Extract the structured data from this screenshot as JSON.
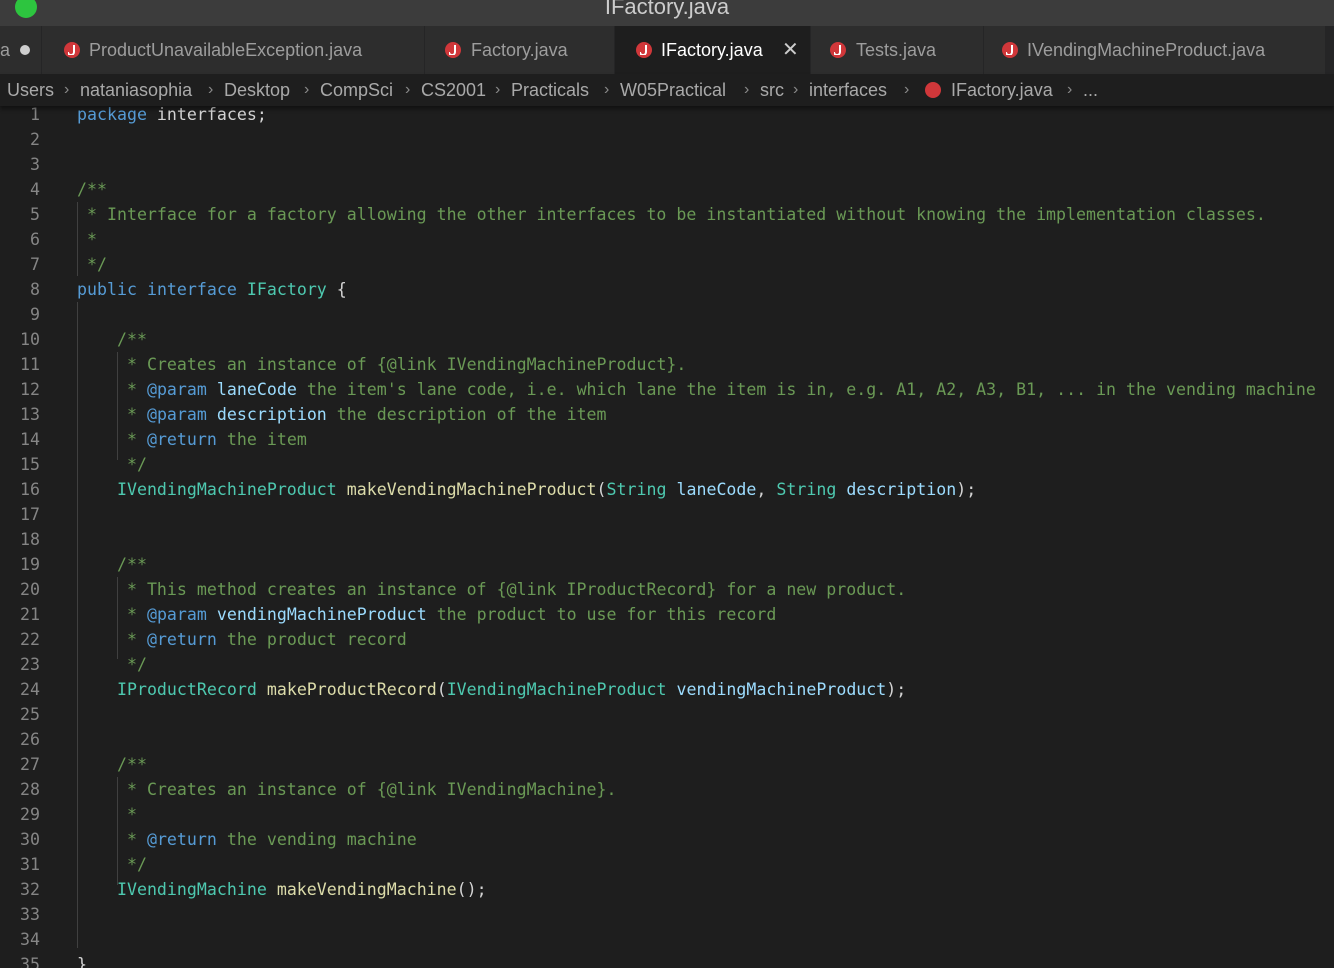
{
  "window": {
    "title": "IFactory.java"
  },
  "tabs": [
    {
      "label": "ProductUnavailableException.java",
      "active": false
    },
    {
      "label": "Factory.java",
      "active": false
    },
    {
      "label": "IFactory.java",
      "active": true
    },
    {
      "label": "Tests.java",
      "active": false
    },
    {
      "label": "IVendingMachineProduct.java",
      "active": false
    }
  ],
  "tab_partial": {
    "label": "a"
  },
  "breadcrumb": [
    "Users",
    "nataniasophia",
    "Desktop",
    "CompSci",
    "CS2001",
    "Practicals",
    "W05Practical",
    "src",
    "interfaces",
    "IFactory.java",
    "..."
  ],
  "icons": {
    "java_file": "java-file-icon",
    "close": "close-icon",
    "separator": "chevron-right-icon",
    "unsaved": "unsaved-dot-icon",
    "window_button": "traffic-light-icon"
  },
  "colors": {
    "keyword": "#569cd6",
    "type": "#4ec9b0",
    "function": "#dcdcaa",
    "parameter": "#9cdcfe",
    "comment": "#6a9955",
    "text": "#d4d4d4",
    "java_icon": "#d0373a"
  },
  "editor": {
    "lines": [
      {
        "n": "1",
        "tokens": [
          [
            "kw",
            "package"
          ],
          [
            "pl",
            " interfaces;"
          ]
        ]
      },
      {
        "n": "2",
        "tokens": []
      },
      {
        "n": "3",
        "tokens": []
      },
      {
        "n": "4",
        "tokens": [
          [
            "cm",
            "/**"
          ]
        ]
      },
      {
        "n": "5",
        "tokens": [
          [
            "cm",
            " * Interface for a factory allowing the other interfaces to be instantiated without knowing the implementation classes."
          ]
        ]
      },
      {
        "n": "6",
        "tokens": [
          [
            "cm",
            " *"
          ]
        ]
      },
      {
        "n": "7",
        "tokens": [
          [
            "cm",
            " */"
          ]
        ]
      },
      {
        "n": "8",
        "tokens": [
          [
            "kw",
            "public"
          ],
          [
            "pl",
            " "
          ],
          [
            "kw",
            "interface"
          ],
          [
            "pl",
            " "
          ],
          [
            "ty",
            "IFactory"
          ],
          [
            "pl",
            " {"
          ]
        ]
      },
      {
        "n": "9",
        "tokens": []
      },
      {
        "n": "10",
        "tokens": [
          [
            "pl",
            "    "
          ],
          [
            "cm",
            "/**"
          ]
        ]
      },
      {
        "n": "11",
        "tokens": [
          [
            "pl",
            "    "
          ],
          [
            "cm",
            " * Creates an instance of {@link IVendingMachineProduct}."
          ]
        ]
      },
      {
        "n": "12",
        "tokens": [
          [
            "pl",
            "    "
          ],
          [
            "cm",
            " * "
          ],
          [
            "kw",
            "@param"
          ],
          [
            "pl",
            " "
          ],
          [
            "pm",
            "laneCode"
          ],
          [
            "cm",
            " the item's lane code, i.e. which lane the item is in, e.g. A1, A2, A3, B1, ... in the vending machine"
          ]
        ]
      },
      {
        "n": "13",
        "tokens": [
          [
            "pl",
            "    "
          ],
          [
            "cm",
            " * "
          ],
          [
            "kw",
            "@param"
          ],
          [
            "pl",
            " "
          ],
          [
            "pm",
            "description"
          ],
          [
            "cm",
            " the description of the item"
          ]
        ]
      },
      {
        "n": "14",
        "tokens": [
          [
            "pl",
            "    "
          ],
          [
            "cm",
            " * "
          ],
          [
            "kw",
            "@return"
          ],
          [
            "cm",
            " the item"
          ]
        ]
      },
      {
        "n": "15",
        "tokens": [
          [
            "pl",
            "    "
          ],
          [
            "cm",
            " */"
          ]
        ]
      },
      {
        "n": "16",
        "tokens": [
          [
            "pl",
            "    "
          ],
          [
            "ty",
            "IVendingMachineProduct"
          ],
          [
            "pl",
            " "
          ],
          [
            "fn",
            "makeVendingMachineProduct"
          ],
          [
            "pl",
            "("
          ],
          [
            "ty",
            "String"
          ],
          [
            "pl",
            " "
          ],
          [
            "pm",
            "laneCode"
          ],
          [
            "pl",
            ", "
          ],
          [
            "ty",
            "String"
          ],
          [
            "pl",
            " "
          ],
          [
            "pm",
            "description"
          ],
          [
            "pl",
            ");"
          ]
        ]
      },
      {
        "n": "17",
        "tokens": []
      },
      {
        "n": "18",
        "tokens": []
      },
      {
        "n": "19",
        "tokens": [
          [
            "pl",
            "    "
          ],
          [
            "cm",
            "/**"
          ]
        ]
      },
      {
        "n": "20",
        "tokens": [
          [
            "pl",
            "    "
          ],
          [
            "cm",
            " * This method creates an instance of {@link IProductRecord} for a new product."
          ]
        ]
      },
      {
        "n": "21",
        "tokens": [
          [
            "pl",
            "    "
          ],
          [
            "cm",
            " * "
          ],
          [
            "kw",
            "@param"
          ],
          [
            "pl",
            " "
          ],
          [
            "pm",
            "vendingMachineProduct"
          ],
          [
            "cm",
            " the product to use for this record"
          ]
        ]
      },
      {
        "n": "22",
        "tokens": [
          [
            "pl",
            "    "
          ],
          [
            "cm",
            " * "
          ],
          [
            "kw",
            "@return"
          ],
          [
            "cm",
            " the product record"
          ]
        ]
      },
      {
        "n": "23",
        "tokens": [
          [
            "pl",
            "    "
          ],
          [
            "cm",
            " */"
          ]
        ]
      },
      {
        "n": "24",
        "tokens": [
          [
            "pl",
            "    "
          ],
          [
            "ty",
            "IProductRecord"
          ],
          [
            "pl",
            " "
          ],
          [
            "fn",
            "makeProductRecord"
          ],
          [
            "pl",
            "("
          ],
          [
            "ty",
            "IVendingMachineProduct"
          ],
          [
            "pl",
            " "
          ],
          [
            "pm",
            "vendingMachineProduct"
          ],
          [
            "pl",
            ");"
          ]
        ]
      },
      {
        "n": "25",
        "tokens": []
      },
      {
        "n": "26",
        "tokens": []
      },
      {
        "n": "27",
        "tokens": [
          [
            "pl",
            "    "
          ],
          [
            "cm",
            "/**"
          ]
        ]
      },
      {
        "n": "28",
        "tokens": [
          [
            "pl",
            "    "
          ],
          [
            "cm",
            " * Creates an instance of {@link IVendingMachine}."
          ]
        ]
      },
      {
        "n": "29",
        "tokens": [
          [
            "pl",
            "    "
          ],
          [
            "cm",
            " *"
          ]
        ]
      },
      {
        "n": "30",
        "tokens": [
          [
            "pl",
            "    "
          ],
          [
            "cm",
            " * "
          ],
          [
            "kw",
            "@return"
          ],
          [
            "cm",
            " the vending machine"
          ]
        ]
      },
      {
        "n": "31",
        "tokens": [
          [
            "pl",
            "    "
          ],
          [
            "cm",
            " */"
          ]
        ]
      },
      {
        "n": "32",
        "tokens": [
          [
            "pl",
            "    "
          ],
          [
            "ty",
            "IVendingMachine"
          ],
          [
            "pl",
            " "
          ],
          [
            "fn",
            "makeVendingMachine"
          ],
          [
            "pl",
            "();"
          ]
        ]
      },
      {
        "n": "33",
        "tokens": []
      },
      {
        "n": "34",
        "tokens": []
      },
      {
        "n": "35",
        "tokens": [
          [
            "pl",
            "}"
          ]
        ]
      }
    ]
  }
}
